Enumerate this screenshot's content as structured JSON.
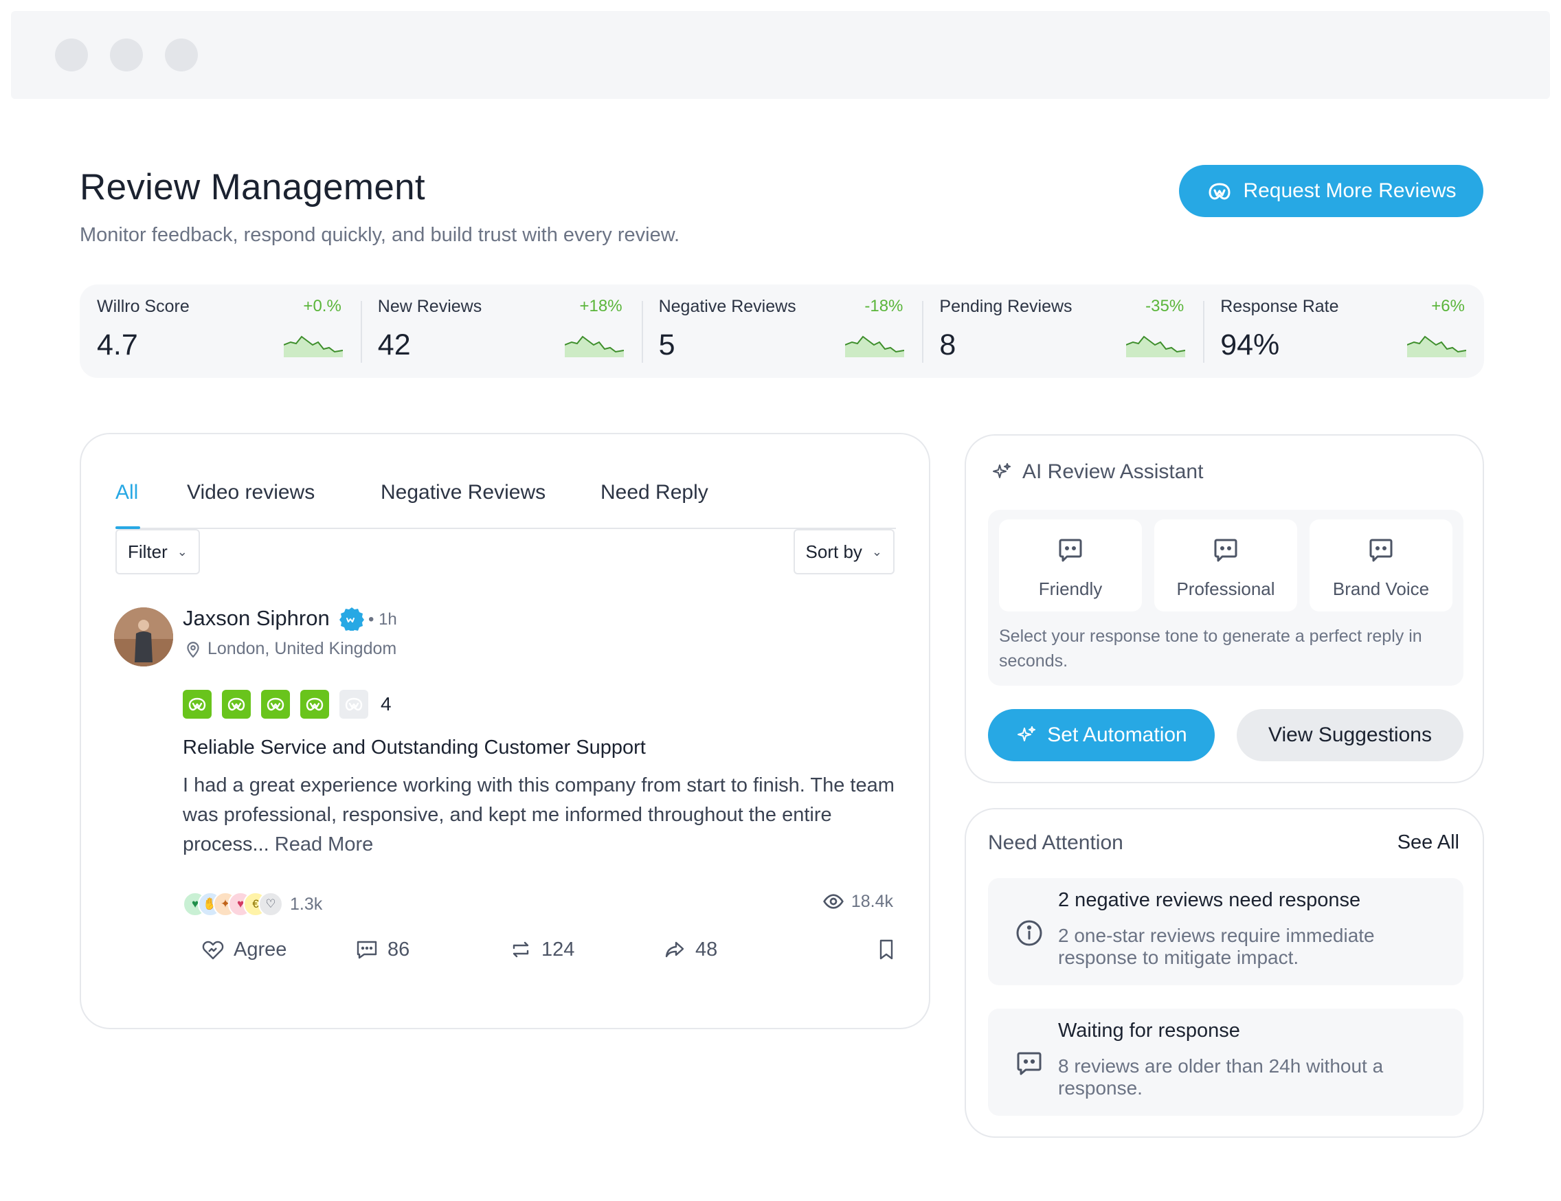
{
  "header": {
    "title": "Review Management",
    "subtitle": "Monitor feedback, respond quickly, and build trust with every review.",
    "request_button": "Request More Reviews"
  },
  "stats": [
    {
      "label": "Willro Score",
      "value": "4.7",
      "delta": "+0.%"
    },
    {
      "label": "New Reviews",
      "value": "42",
      "delta": "+18%"
    },
    {
      "label": "Negative Reviews",
      "value": "5",
      "delta": "-18%"
    },
    {
      "label": "Pending Reviews",
      "value": "8",
      "delta": "-35%"
    },
    {
      "label": "Response Rate",
      "value": "94%",
      "delta": "+6%"
    }
  ],
  "colors": {
    "accent": "#27a8e4",
    "positive": "#5ab53a",
    "star": "#69c41c"
  },
  "tabs": [
    {
      "label": "All",
      "active": true
    },
    {
      "label": "Video reviews"
    },
    {
      "label": "Negative Reviews"
    },
    {
      "label": "Need Reply"
    }
  ],
  "controls": {
    "filter": "Filter",
    "sort": "Sort by"
  },
  "review": {
    "name": "Jaxson Siphron",
    "time": "• 1h",
    "location": "London, United Kingdom",
    "rating": "4",
    "rating_value": 4,
    "title": "Reliable Service and Outstanding Customer Support",
    "body": "I had a great experience working with this company from start to finish. The team was professional, responsive, and kept me informed throughout the entire process...",
    "read_more": "Read More",
    "reactions_count": "1.3k",
    "views": "18.4k",
    "actions": {
      "agree": "Agree",
      "comments": "86",
      "reposts": "124",
      "shares": "48"
    }
  },
  "assistant": {
    "title": "AI Review Assistant",
    "tones": [
      "Friendly",
      "Professional",
      "Brand Voice"
    ],
    "hint": "Select your response tone to generate a perfect reply in seconds.",
    "automation_button": "Set Automation",
    "suggestions_button": "View Suggestions"
  },
  "attention": {
    "title": "Need Attention",
    "see_all": "See All",
    "items": [
      {
        "icon": "info-icon",
        "title": "2 negative reviews need response",
        "desc": "2 one-star reviews require immediate response to mitigate impact."
      },
      {
        "icon": "chat-icon",
        "title": "Waiting for response",
        "desc": "8 reviews are older than 24h without a response."
      }
    ]
  }
}
